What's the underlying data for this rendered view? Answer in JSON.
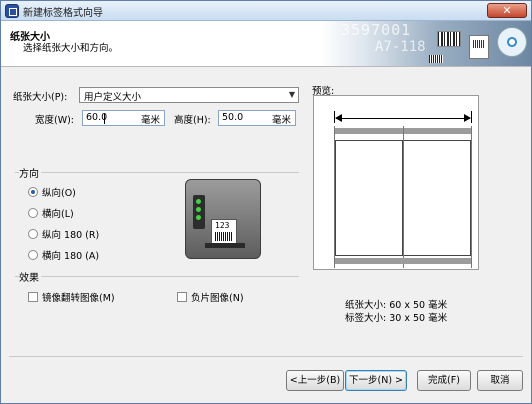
{
  "window": {
    "title": "新建标签格式向导",
    "close_glyph": "✕"
  },
  "header": {
    "title": "纸张大小",
    "subtitle": "选择纸张大小和方向。",
    "banner_text1": "3597001",
    "banner_text2": "A7-118"
  },
  "paper": {
    "size_label": "纸张大小(P):",
    "size_value": "用户定义大小",
    "width_label": "宽度(W):",
    "width_value": "60.0",
    "width_unit": "毫米",
    "height_label": "高度(H):",
    "height_value": "50.0",
    "height_unit": "毫米"
  },
  "orientation": {
    "title": "方向",
    "options": [
      {
        "label": "纵向(O)",
        "checked": true
      },
      {
        "label": "横向(L)",
        "checked": false
      },
      {
        "label": "纵向 180 (R)",
        "checked": false
      },
      {
        "label": "横向 180 (A)",
        "checked": false
      }
    ]
  },
  "effects": {
    "title": "效果",
    "mirror_label": "镜像翻转图像(M)",
    "mirror_checked": false,
    "negative_label": "负片图像(N)",
    "negative_checked": false
  },
  "printer_image": {
    "label_number": "123"
  },
  "preview": {
    "title": "预览:",
    "paper_size_text": "纸张大小: 60 x 50 毫米",
    "label_size_text": "标签大小: 30 x 50 毫米"
  },
  "buttons": {
    "back": "<上一步(B)",
    "next": "下一步(N) >",
    "finish": "完成(F)",
    "cancel": "取消"
  }
}
